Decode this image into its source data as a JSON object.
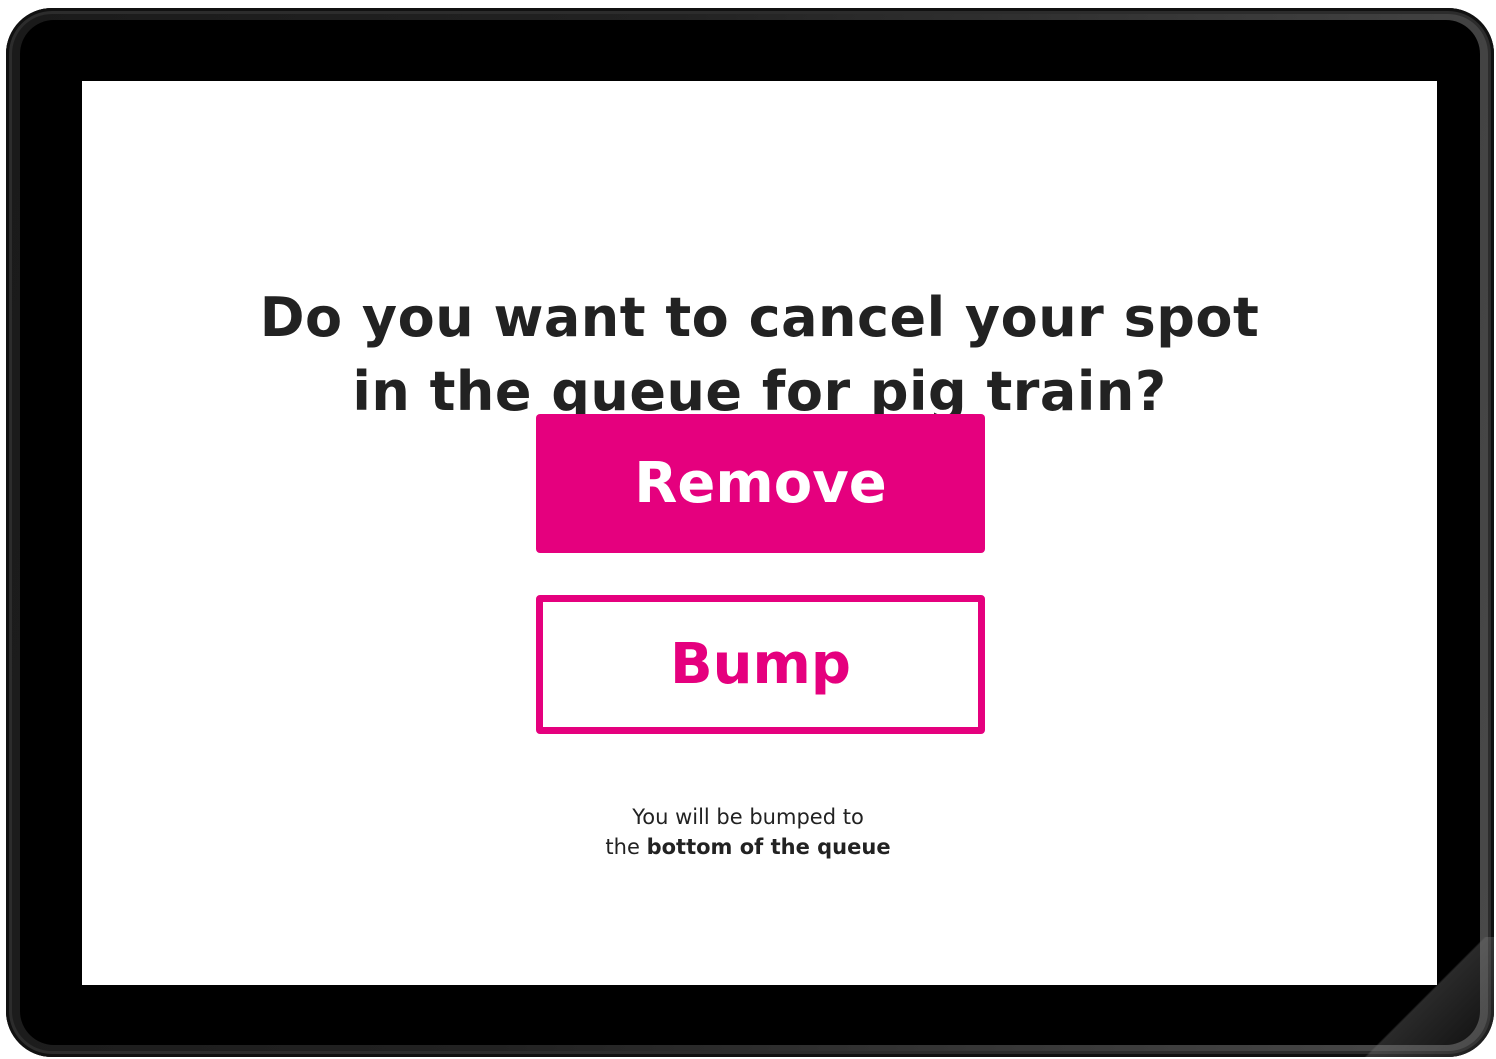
{
  "dialog": {
    "question_line1": "Do you want to cancel your spot",
    "question_line2": "in the queue for pig train?",
    "remove_label": "Remove",
    "bump_label": "Bump",
    "note_line1": "You will be bumped to",
    "note_line2_prefix": "the",
    "note_line2_bold": "bottom of the queue"
  },
  "colors": {
    "accent": "#e5007e",
    "text": "#222222",
    "screen_bg": "#ffffff",
    "bezel": "#000000"
  }
}
